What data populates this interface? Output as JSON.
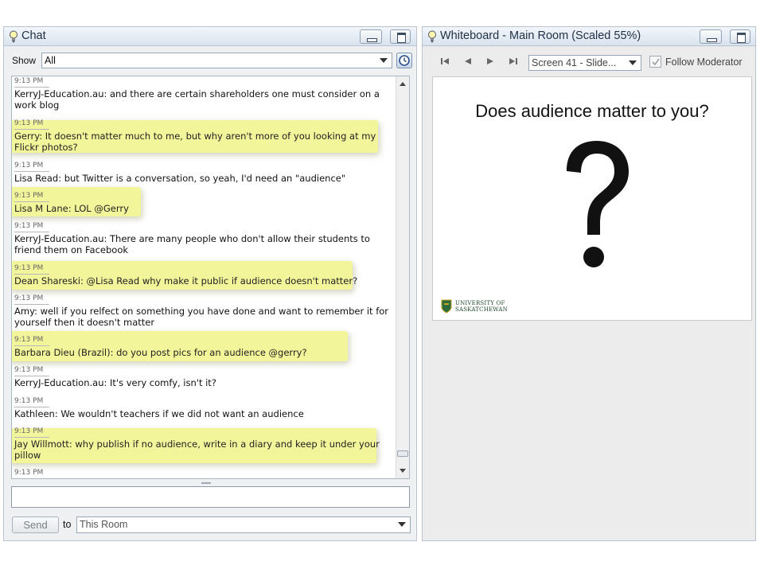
{
  "chat": {
    "title": "Chat",
    "show_label": "Show",
    "filter_value": "All",
    "messages": [
      {
        "time": "9:13 PM",
        "text": "KerryJ-Education.au: and there are certain shareholders one must consider on a work blog",
        "highlight": false
      },
      {
        "time": "9:13 PM",
        "text": "Gerry: It doesn't matter much to me, but why aren't more of you looking at my Flickr photos?",
        "highlight": true
      },
      {
        "time": "9:13 PM",
        "text": "Lisa Read: but Twitter is a conversation, so yeah, I'd need an \"audience\"",
        "highlight": false
      },
      {
        "time": "9:13 PM",
        "text": "Lisa M Lane: LOL @Gerry",
        "highlight": true
      },
      {
        "time": "9:13 PM",
        "text": "KerryJ-Education.au: There are many people who don't allow their students to friend them on Facebook",
        "highlight": false
      },
      {
        "time": "9:13 PM",
        "text": "Dean Shareski: @Lisa Read why make it public if audience doesn't matter?",
        "highlight": true
      },
      {
        "time": "9:13 PM",
        "text": "Amy: well if you relfect on something you have done and want to remember it for yourself then it doesn't matter",
        "highlight": false
      },
      {
        "time": "9:13 PM",
        "text": "Barbara Dieu (Brazil): do you post pics for an audience @gerry?",
        "highlight": true
      },
      {
        "time": "9:13 PM",
        "text": "KerryJ-Education.au: It's very comfy, isn't it?",
        "highlight": false
      },
      {
        "time": "9:13 PM",
        "text": "Kathleen: We wouldn't teachers if we did not want an audience",
        "highlight": false
      },
      {
        "time": "9:13 PM",
        "text": "Jay Willmott: why publish if no audience, write in a diary and keep it under your pillow",
        "highlight": true
      },
      {
        "time": "9:13 PM",
        "text": "",
        "highlight": false
      }
    ],
    "input_value": "",
    "send_label": "Send",
    "to_label": "to",
    "recipient": "This Room"
  },
  "whiteboard": {
    "title": "Whiteboard - Main Room (Scaled 55%)",
    "screen_select": "Screen 41 - Slide...",
    "follow_label": "Follow Moderator",
    "follow_checked": true,
    "slide": {
      "title": "Does audience matter to you?",
      "logo_line1": "UNIVERSITY OF",
      "logo_line2": "SASKATCHEWAN"
    }
  },
  "colors": {
    "highlight": "#f3f59a",
    "titlebar_text": "#1f2f44",
    "logo_green": "#1e4a2b"
  },
  "icons": [
    "bulb-icon",
    "minimize-icon",
    "maximize-icon",
    "chevron-down-icon",
    "clock-icon",
    "first-icon",
    "prev-icon",
    "next-icon",
    "last-icon",
    "check-icon",
    "crest-icon"
  ]
}
